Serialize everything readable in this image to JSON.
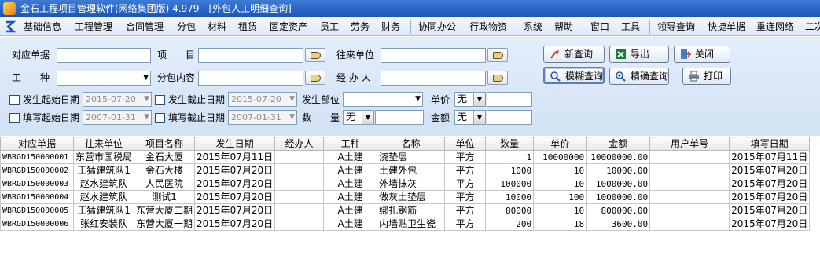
{
  "window": {
    "title": "金石工程项目管理软件(网络集团版) 4.979 - [外包人工明细查询]"
  },
  "menu": {
    "items": [
      "基础信息",
      "工程管理",
      "合同管理",
      "分包",
      "材料",
      "租赁",
      "固定资产",
      "员工",
      "劳务",
      "财务",
      "协同办公",
      "行政物资",
      "系统",
      "帮助",
      "窗口",
      "工具",
      "领导查询",
      "快捷单据",
      "重连网络",
      "二次"
    ]
  },
  "filter": {
    "doc_no_label": "对应单据",
    "item_label": "项　　目",
    "partner_label": "往来单位",
    "work_type_label": "工　　种",
    "sub_content_label": "分包内容",
    "handler_label": "经 办 人",
    "start_date_label": "发生起始日期",
    "start_date_value": "2015-07-20",
    "end_date_label": "发生截止日期",
    "end_date_value": "2015-07-20",
    "dept_label": "发生部位",
    "unit_price_label": "单价",
    "unit_price_op": "无",
    "fill_start_label": "填写起始日期",
    "fill_start_value": "2007-01-31",
    "fill_end_label": "填写截止日期",
    "fill_end_value": "2007-01-31",
    "qty_label": "数　　量",
    "qty_op": "无",
    "amount_label": "金额",
    "amount_op": "无"
  },
  "buttons": {
    "new_query": "新查询",
    "export": "导出",
    "close": "关闭",
    "fuzzy_query": "模糊查询",
    "exact_query": "精确查询",
    "print": "打印"
  },
  "grid": {
    "columns": [
      "对应单据",
      "往来单位",
      "项目名称",
      "发生日期",
      "经办人",
      "工种",
      "名称",
      "单位",
      "数量",
      "单价",
      "金额",
      "用户单号",
      "填写日期"
    ],
    "rows": [
      [
        "WBRGD150000001",
        "东营市国税局",
        "金石大厦",
        "2015年07月11日",
        "",
        "A土建",
        "浇垫层",
        "平方",
        "1",
        "10000000",
        "10000000.00",
        "",
        "2015年07月11日"
      ],
      [
        "WBRGD150000002",
        "王猛建筑队1",
        "金石大楼",
        "2015年07月20日",
        "",
        "A土建",
        "土建外包",
        "平方",
        "1000",
        "10",
        "10000.00",
        "",
        "2015年07月20日"
      ],
      [
        "WBRGD150000003",
        "赵水建筑队",
        "人民医院",
        "2015年07月20日",
        "",
        "A土建",
        "外墙抹灰",
        "平方",
        "100000",
        "10",
        "1000000.00",
        "",
        "2015年07月20日"
      ],
      [
        "WBRGD150000004",
        "赵水建筑队",
        "测试1",
        "2015年07月20日",
        "",
        "A土建",
        "做灰土垫层",
        "平方",
        "10000",
        "100",
        "1000000.00",
        "",
        "2015年07月20日"
      ],
      [
        "WBRGD150000005",
        "王猛建筑队1",
        "东营大厦二期",
        "2015年07月20日",
        "",
        "A土建",
        "绑扎钢筋",
        "平方",
        "80000",
        "10",
        "800000.00",
        "",
        "2015年07月20日"
      ],
      [
        "WBRGD150000006",
        "张红安装队",
        "东营大厦一期",
        "2015年07月20日",
        "",
        "A土建",
        "内墙贴卫生瓷",
        "平方",
        "200",
        "18",
        "3600.00",
        "",
        "2015年07月20日"
      ]
    ]
  }
}
